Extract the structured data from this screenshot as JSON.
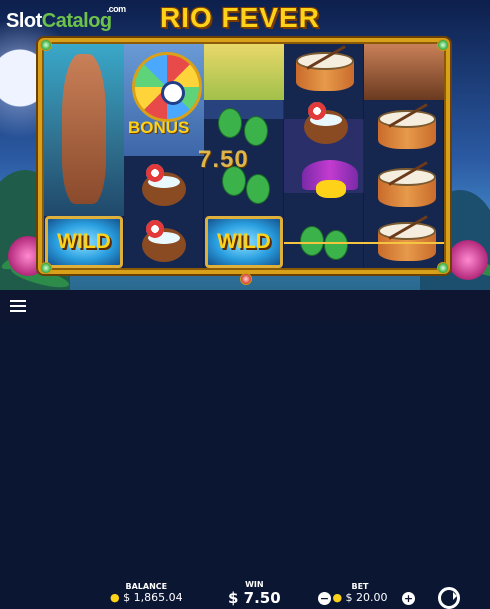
{
  "watermark": {
    "slot": "Slot",
    "catalog": "Catalog",
    "com": ".com"
  },
  "game_title": "RIO FEVER",
  "bonus_label": "BONUS",
  "wild_label": "WILD",
  "win_amount_overlay": "7.50",
  "footer": {
    "balance_label": "BALANCE",
    "balance_value": "$ 1,865.04",
    "win_label": "WIN",
    "win_value": "$ 7.50",
    "bet_label": "BET",
    "bet_value": "$ 20.00",
    "minus": "−",
    "plus": "+"
  },
  "symbols": [
    "dancer",
    "wheel-bonus",
    "maracas",
    "drum",
    "coconut",
    "feather-mask",
    "wild"
  ],
  "colors": {
    "gold": "#ffd21a",
    "frame": "#d9a019",
    "wild_bg": "#2a9fe0"
  }
}
